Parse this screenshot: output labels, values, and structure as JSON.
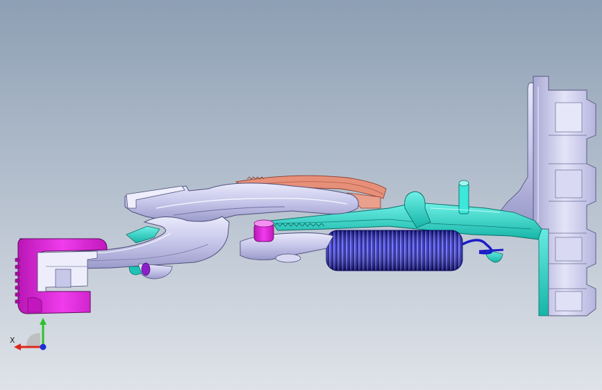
{
  "viewport": {
    "background_top": "#8d9fb4",
    "background_bottom": "#dfe3e9"
  },
  "triad": {
    "x_label": "X",
    "x_color": "#e0261b",
    "y_color": "#2ac12a",
    "z_color": "#1c2fd6"
  },
  "colors": {
    "lavender": "#c9c9ee",
    "lavender_dark": "#8787b9",
    "cyan": "#27e1d3",
    "cyan_dark": "#129a8f",
    "magenta": "#e51fe0",
    "magenta_dark": "#9b0f98",
    "spring": "#2222d8",
    "spring_dark": "#0c0c88",
    "sector": "#e58a73",
    "sector_dark": "#a3503d"
  }
}
